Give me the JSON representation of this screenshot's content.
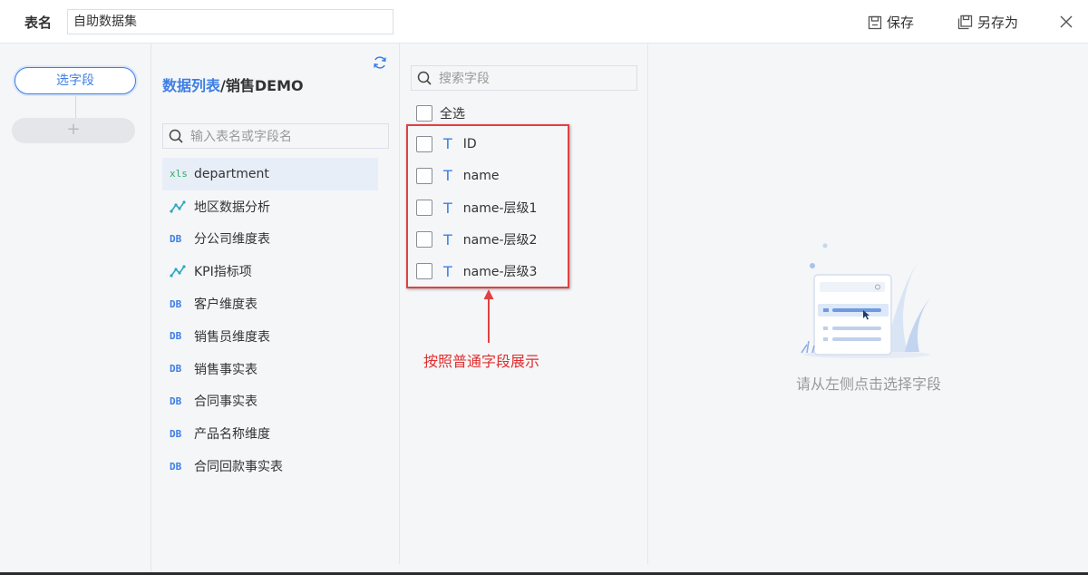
{
  "topbar": {
    "label": "表名",
    "table_name_value": "自助数据集",
    "save_label": "保存",
    "save_as_label": "另存为"
  },
  "steps": {
    "current_step": "选字段",
    "add_symbol": "+"
  },
  "tables": {
    "breadcrumb_link": "数据列表",
    "breadcrumb_sep": "/",
    "breadcrumb_current": "销售DEMO",
    "search_placeholder": "输入表名或字段名",
    "items": [
      {
        "icon": "xls",
        "icon_text": "xls",
        "label": "department",
        "active": true
      },
      {
        "icon": "analysis",
        "icon_text": "",
        "label": "地区数据分析",
        "active": false
      },
      {
        "icon": "db",
        "icon_text": "DB",
        "label": "分公司维度表",
        "active": false
      },
      {
        "icon": "analysis",
        "icon_text": "",
        "label": "KPI指标项",
        "active": false
      },
      {
        "icon": "db",
        "icon_text": "DB",
        "label": "客户维度表",
        "active": false
      },
      {
        "icon": "db",
        "icon_text": "DB",
        "label": "销售员维度表",
        "active": false
      },
      {
        "icon": "db",
        "icon_text": "DB",
        "label": "销售事实表",
        "active": false
      },
      {
        "icon": "db",
        "icon_text": "DB",
        "label": "合同事实表",
        "active": false
      },
      {
        "icon": "db",
        "icon_text": "DB",
        "label": "产品名称维度",
        "active": false
      },
      {
        "icon": "db",
        "icon_text": "DB",
        "label": "合同回款事实表",
        "active": false
      }
    ]
  },
  "fields": {
    "search_placeholder": "搜索字段",
    "select_all_label": "全选",
    "type_icon": "T",
    "items": [
      {
        "label": "ID"
      },
      {
        "label": "name"
      },
      {
        "label": "name-层级1"
      },
      {
        "label": "name-层级2"
      },
      {
        "label": "name-层级3"
      }
    ]
  },
  "annotation": {
    "text": "按照普通字段展示",
    "color": "#e02e2e"
  },
  "empty_state": {
    "message": "请从左侧点击选择字段"
  },
  "colors": {
    "accent": "#3d7ee6",
    "xls_green": "#2dae62",
    "highlight_red": "#e04141"
  }
}
